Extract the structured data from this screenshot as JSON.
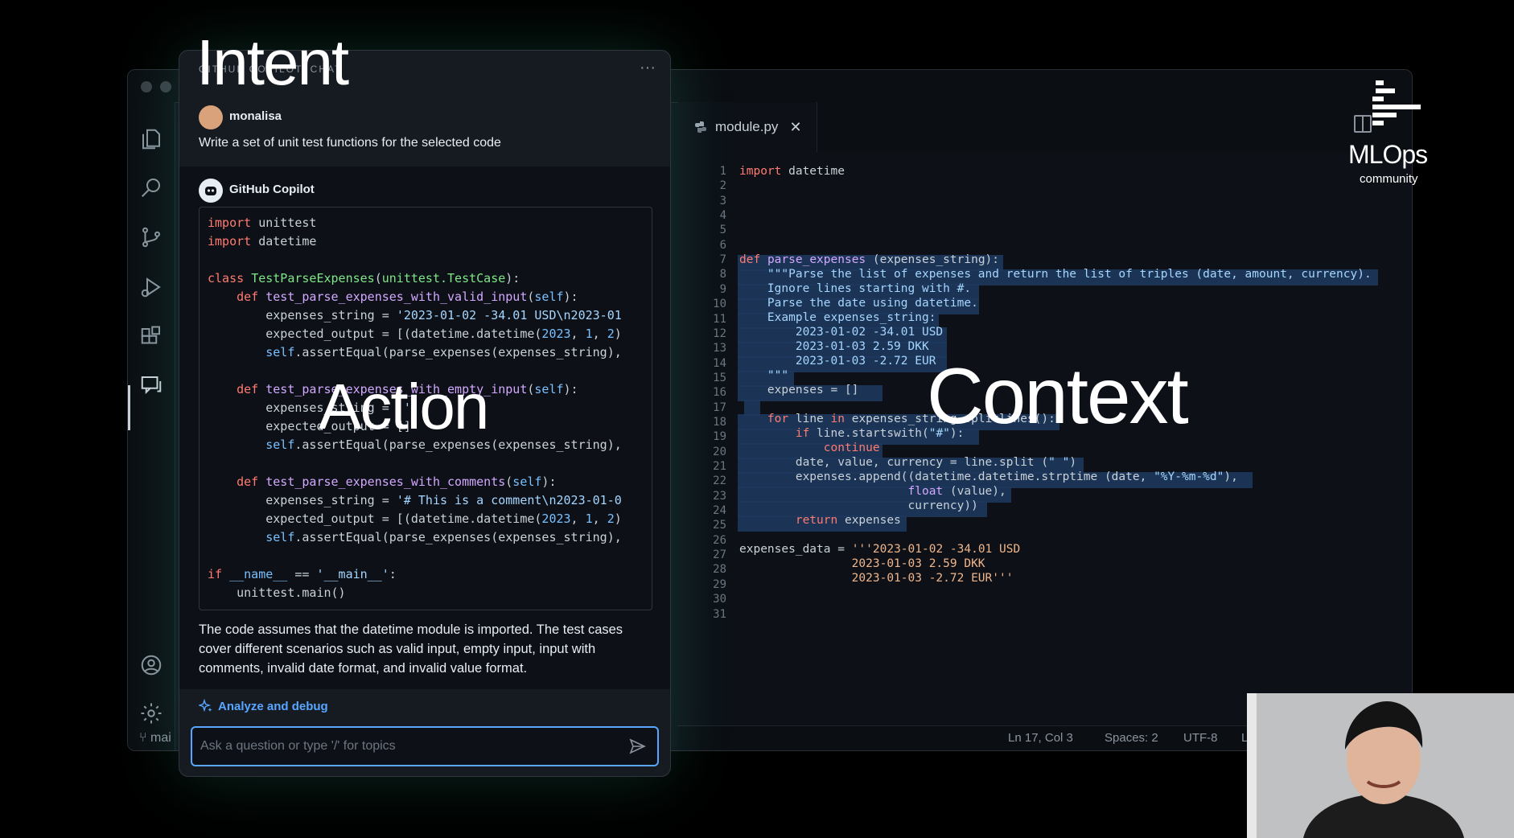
{
  "captions": {
    "intent": "Intent",
    "action": "Action",
    "context": "Context"
  },
  "logo": {
    "name": "MLOps",
    "sub": "community"
  },
  "editor": {
    "tab": {
      "label": "module.py",
      "close": "✕"
    },
    "line_numbers": [
      "1",
      "2",
      "3",
      "4",
      "5",
      "6",
      "7",
      "8",
      "9",
      "10",
      "11",
      "12",
      "13",
      "14",
      "15",
      "16",
      "17",
      "18",
      "19",
      "20",
      "21",
      "22",
      "23",
      "24",
      "25",
      "26",
      "27",
      "28",
      "29",
      "30",
      "31"
    ],
    "status": {
      "position": "Ln 17, Col 3",
      "spaces": "Spaces: 2",
      "encoding": "UTF-8",
      "eol": "LF"
    },
    "branch": "mai"
  },
  "chat": {
    "header_title": "GITHUB COPILOT: CHAT",
    "menu": "···",
    "user": {
      "name": "monalisa",
      "message": "Write a set of unit test functions for the selected code"
    },
    "bot": {
      "name": "GitHub Copilot"
    },
    "explanation": "The code assumes that the datetime module is imported. The test cases cover different scenarios such as valid input, empty input, input with comments, invalid date format, and invalid value format.",
    "analyze_label": "Analyze and debug",
    "input_placeholder": "Ask a question or type '/' for topics"
  },
  "colors": {
    "accent": "#58a6ff",
    "selection": "#1f3a5f",
    "background": "#0d1117"
  }
}
